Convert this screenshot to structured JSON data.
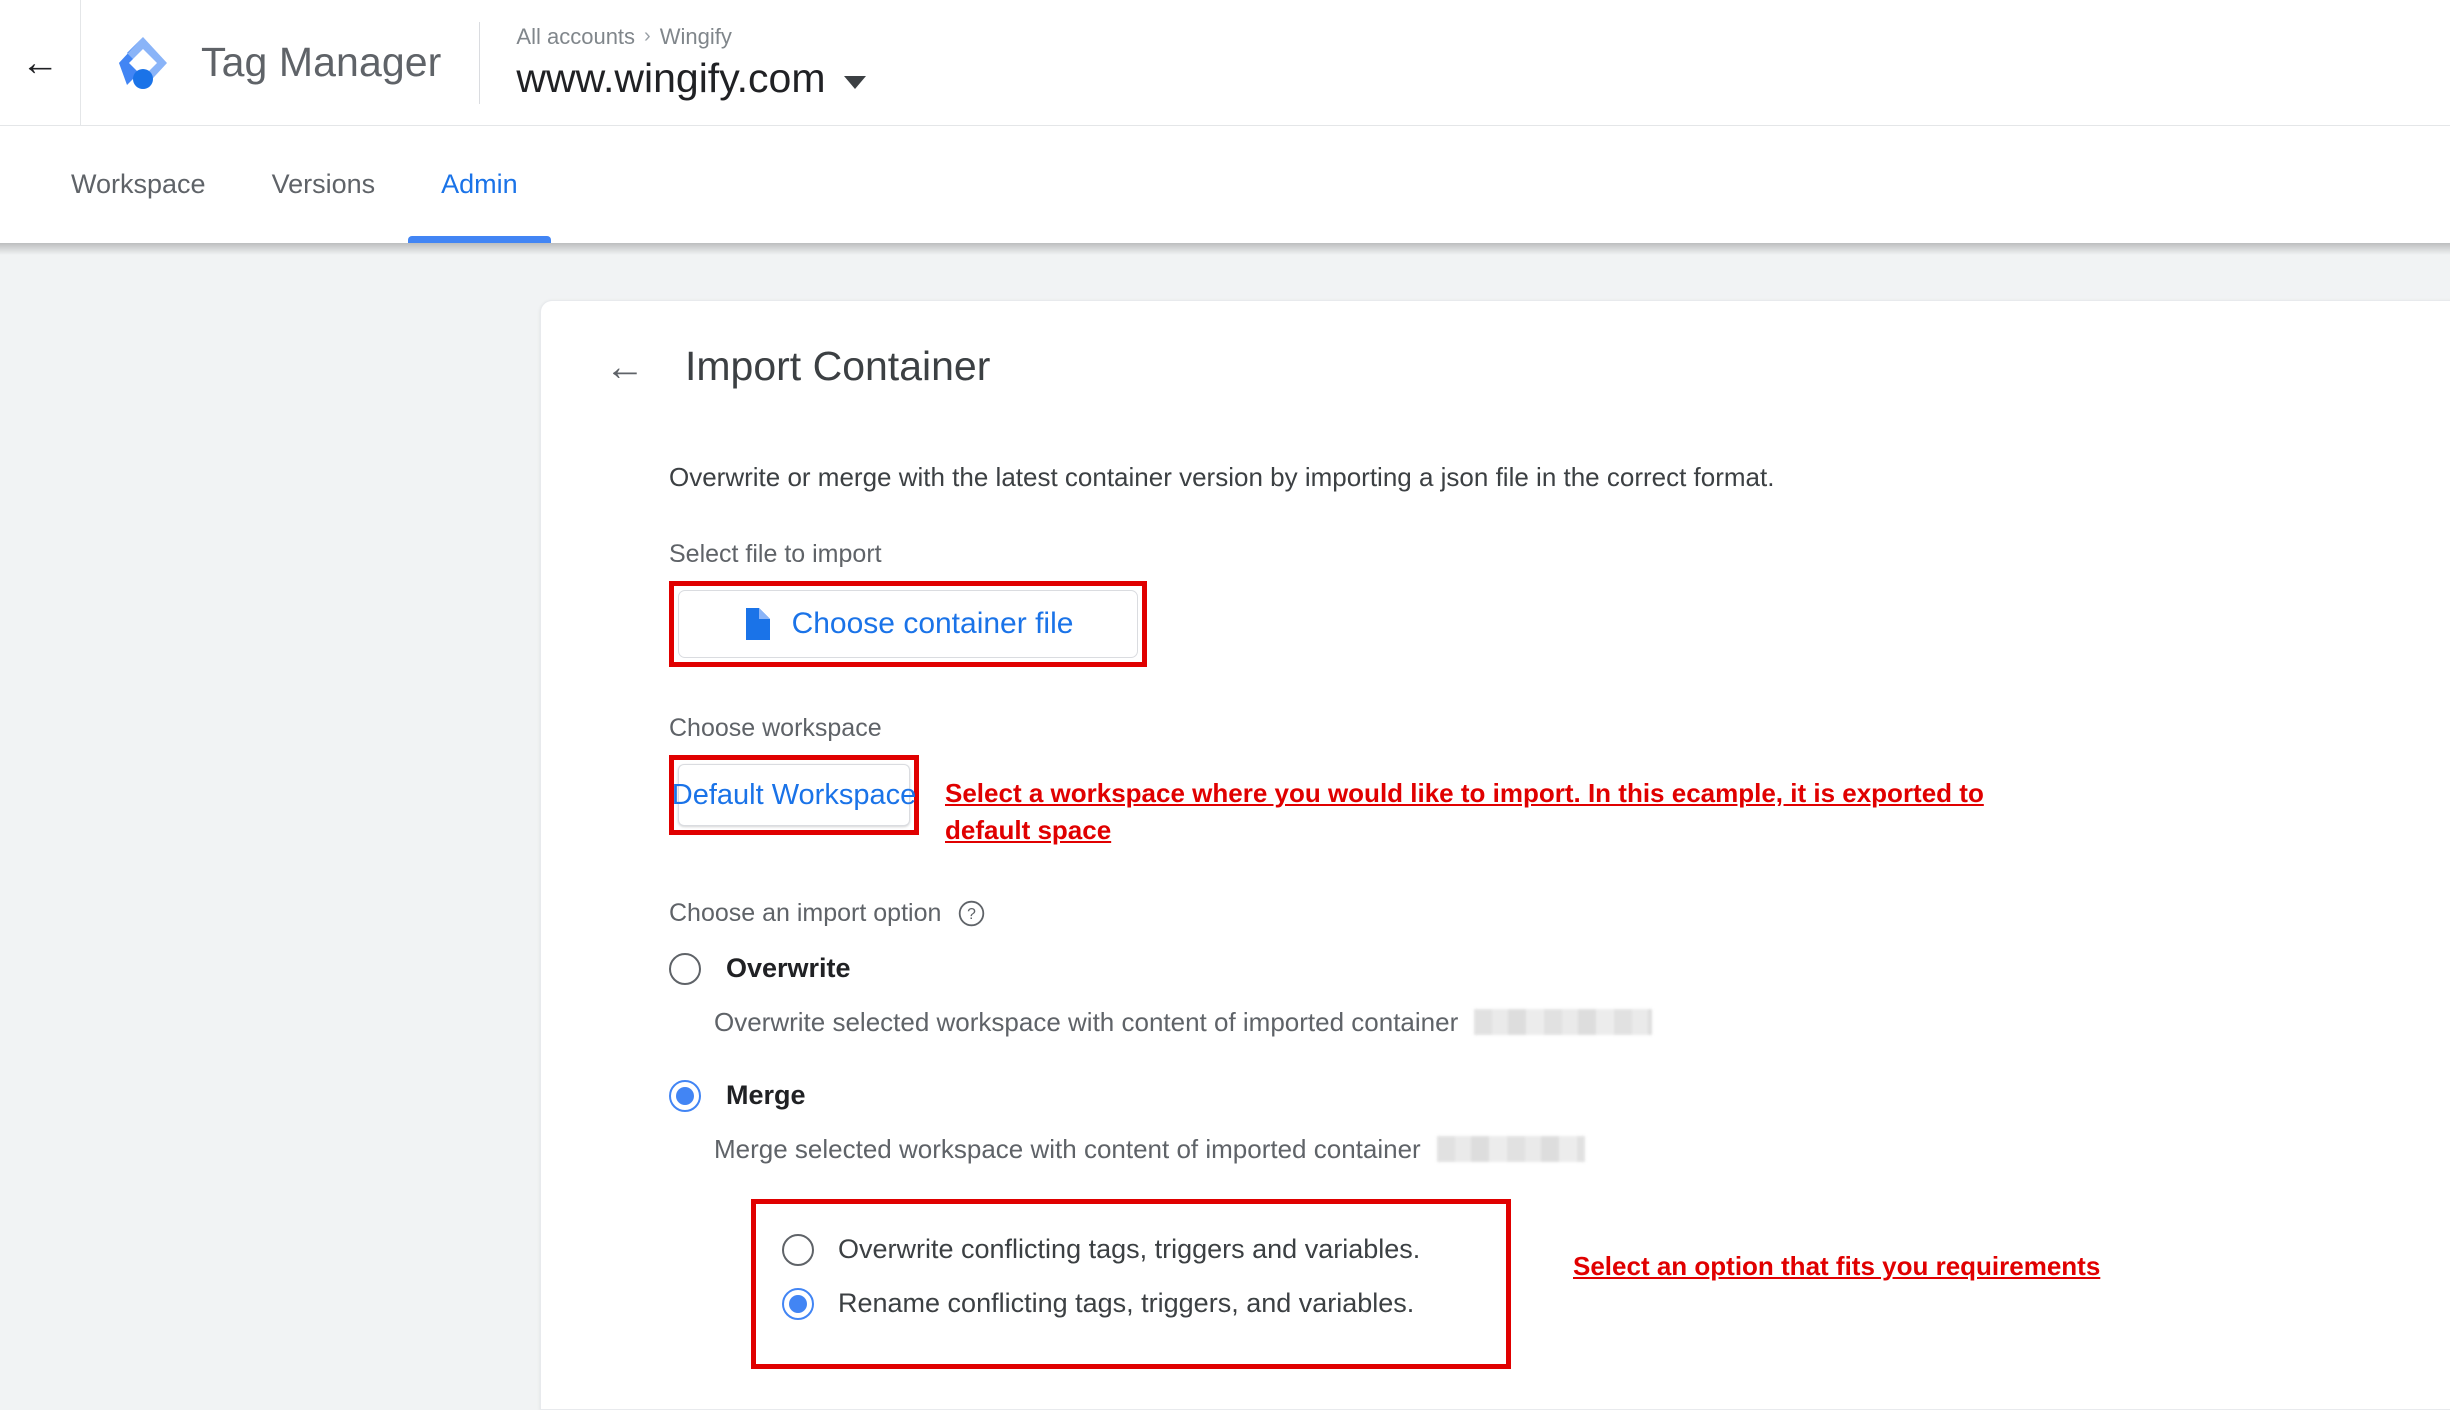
{
  "appbar": {
    "back_icon": "arrow-left-icon",
    "logo_icon": "tag-manager-logo",
    "brand_name": "Tag Manager",
    "breadcrumb": {
      "root": "All accounts",
      "separator": "›",
      "current": "Wingify"
    },
    "container_name": "www.wingify.com",
    "container_dropdown_icon": "caret-down-icon"
  },
  "tabs": [
    {
      "label": "Workspace",
      "active": false
    },
    {
      "label": "Versions",
      "active": false
    },
    {
      "label": "Admin",
      "active": true
    }
  ],
  "card": {
    "back_icon": "arrow-left-icon",
    "title": "Import Container",
    "intro": "Overwrite or merge with the latest container version by importing a json file in the correct format.",
    "select_file": {
      "label": "Select file to import",
      "button_label": "Choose container file",
      "button_icon": "file-document-icon"
    },
    "choose_workspace": {
      "label": "Choose workspace",
      "button_label": "Default Workspace"
    },
    "import_option": {
      "label": "Choose an import option",
      "help_icon": "help-circle-icon",
      "options": [
        {
          "title": "Overwrite",
          "description": "Overwrite selected workspace with content of imported container",
          "selected": false,
          "redacted": true
        },
        {
          "title": "Merge",
          "description": "Merge selected workspace with content of imported container",
          "selected": true,
          "redacted": true
        }
      ],
      "merge_sub_options": [
        {
          "label": "Overwrite conflicting tags, triggers and variables.",
          "selected": false
        },
        {
          "label": "Rename conflicting tags, triggers, and variables.",
          "selected": true
        }
      ]
    }
  },
  "annotations": {
    "workspace_note": "Select a workspace where you would like to import. In this ecample, it is exported to default space",
    "option_note": "Select an option that fits you requirements",
    "color": "#e00000"
  }
}
